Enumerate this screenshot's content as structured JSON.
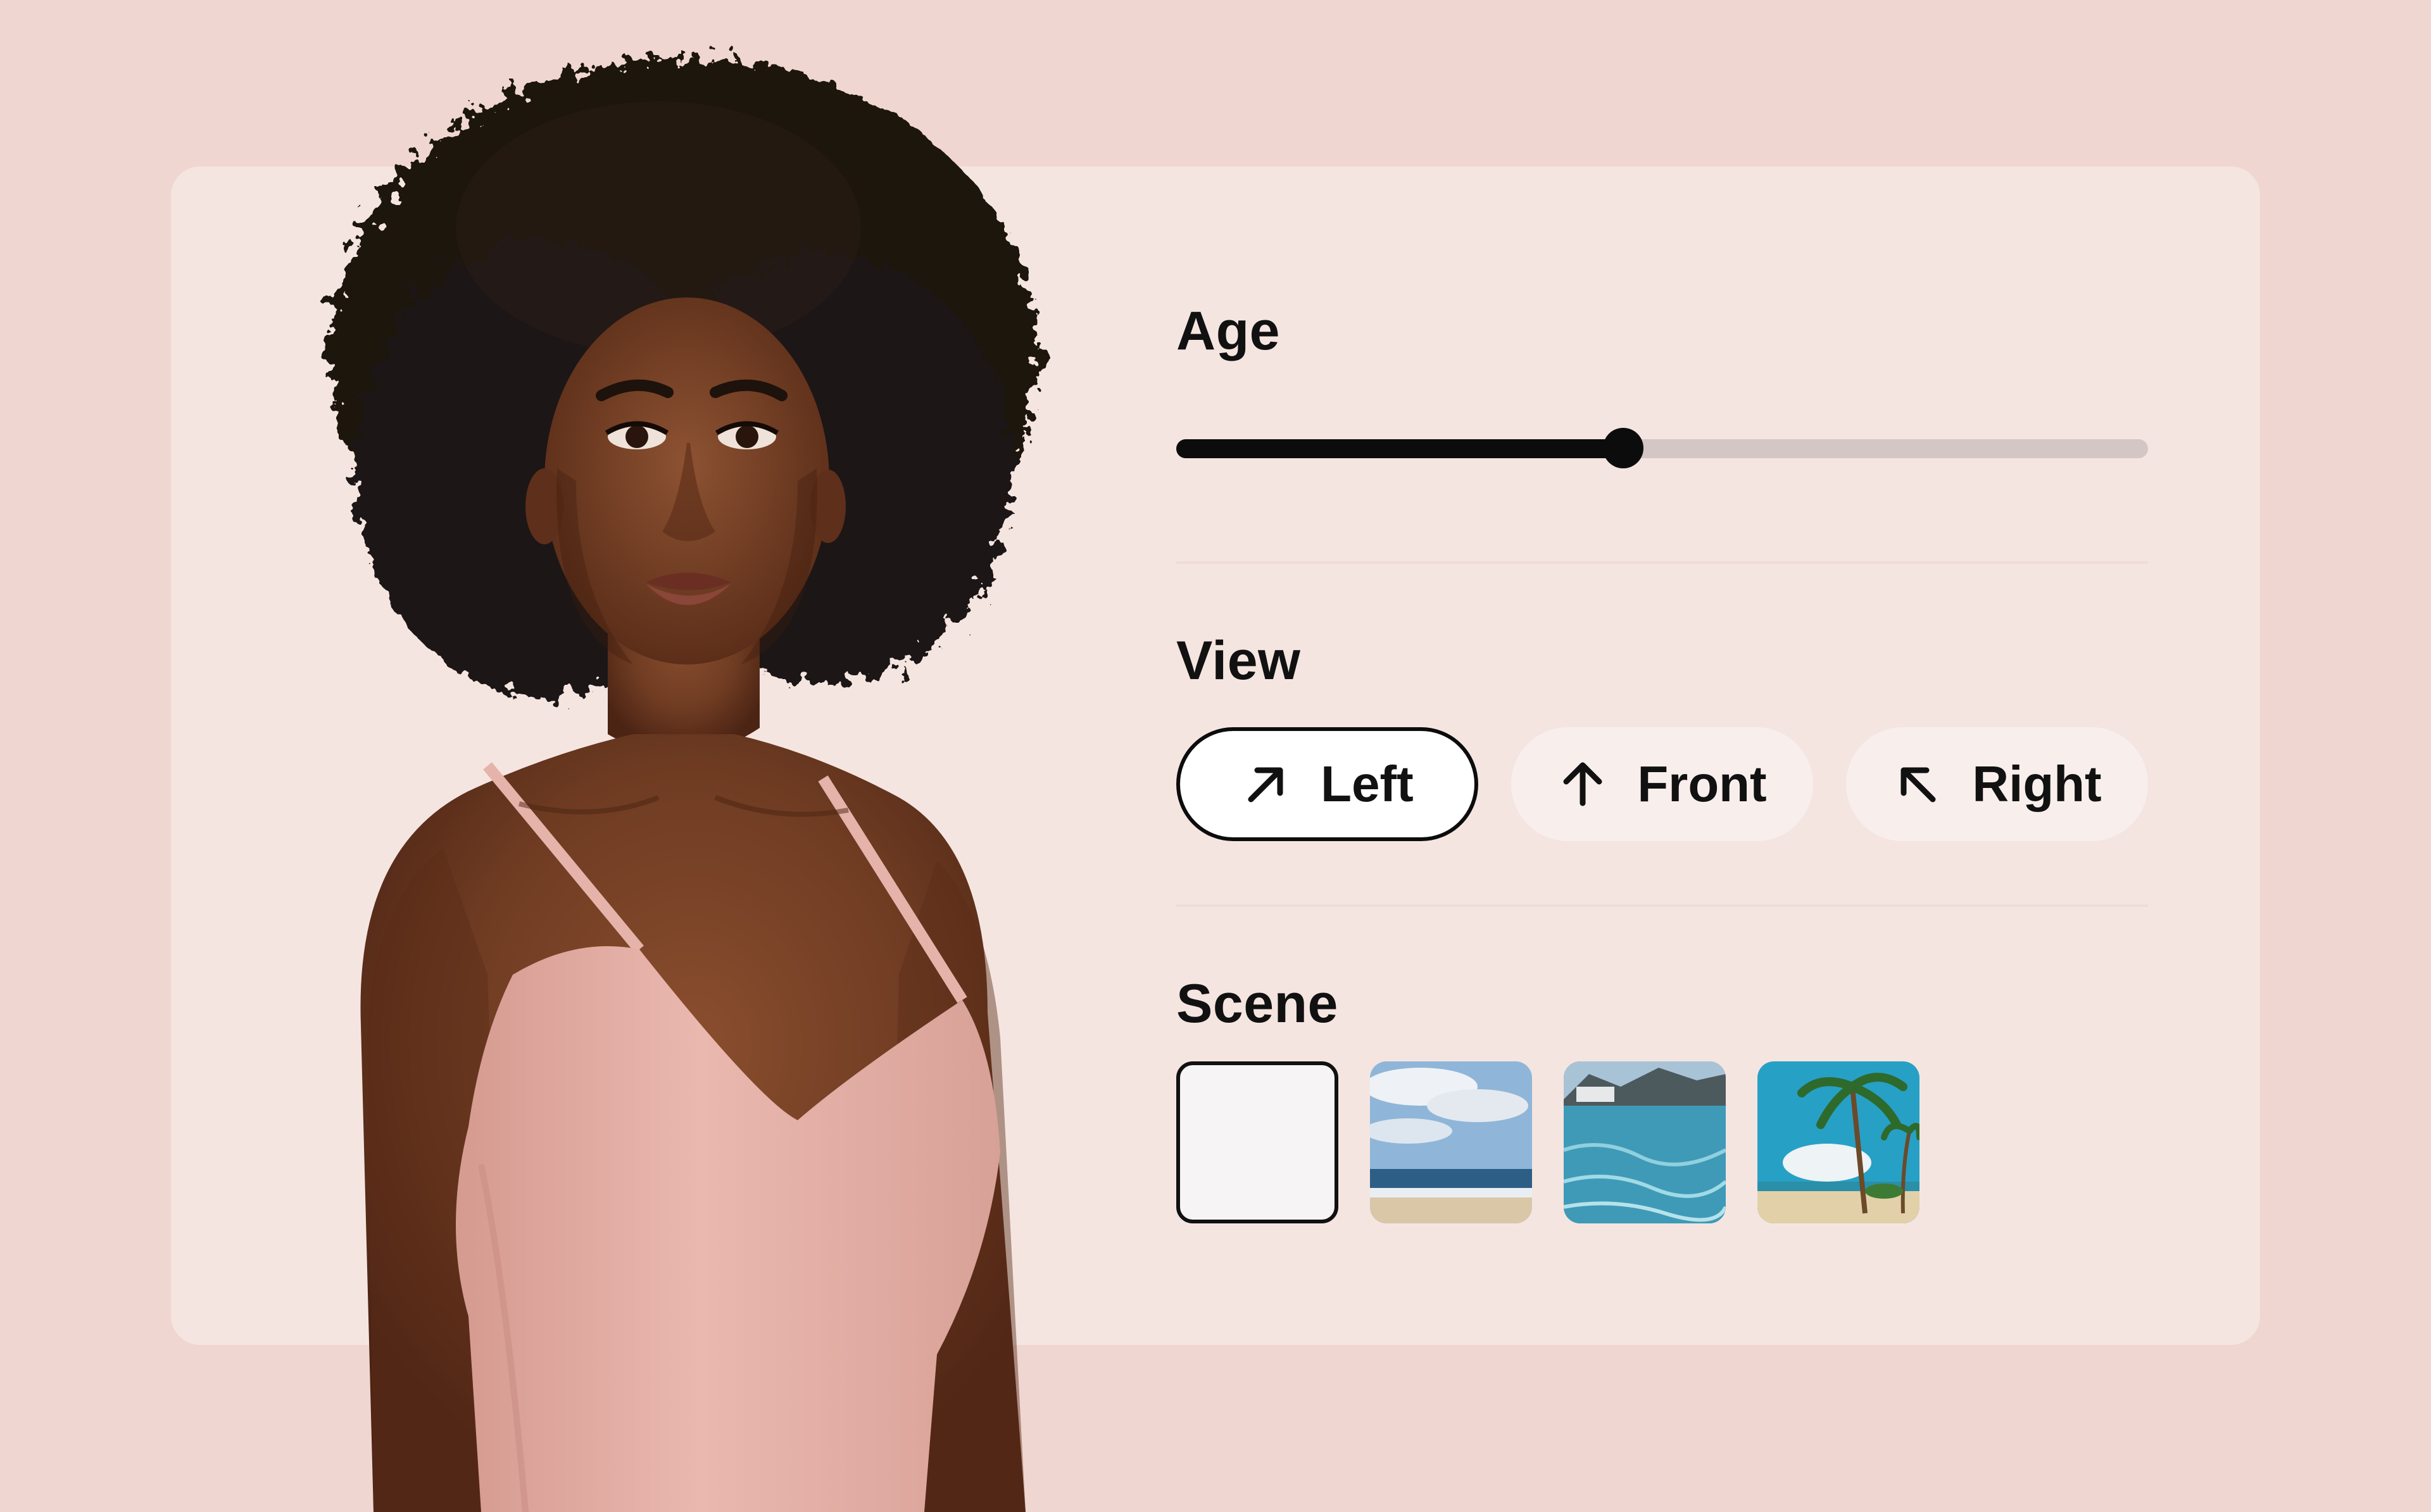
{
  "controls": {
    "age": {
      "title": "Age",
      "value_fraction": 0.46
    },
    "view": {
      "title": "View",
      "selected": "Left",
      "options": [
        {
          "label": "Left",
          "icon": "arrow-up-right-icon"
        },
        {
          "label": "Front",
          "icon": "arrow-up-icon"
        },
        {
          "label": "Right",
          "icon": "arrow-up-left-icon"
        }
      ]
    },
    "scene": {
      "title": "Scene",
      "selected_index": 0,
      "options": [
        "plain",
        "beach-sky",
        "clear-water-coast",
        "palm-beach"
      ]
    }
  },
  "colors": {
    "background": "#f0d6d0",
    "card": "#f5e5e1",
    "accent": "#0c0c0c",
    "track": "#d3c6c4",
    "swimsuit": "#e7b3aa",
    "skin": "#6e3b22",
    "hair": "#1a1210"
  }
}
